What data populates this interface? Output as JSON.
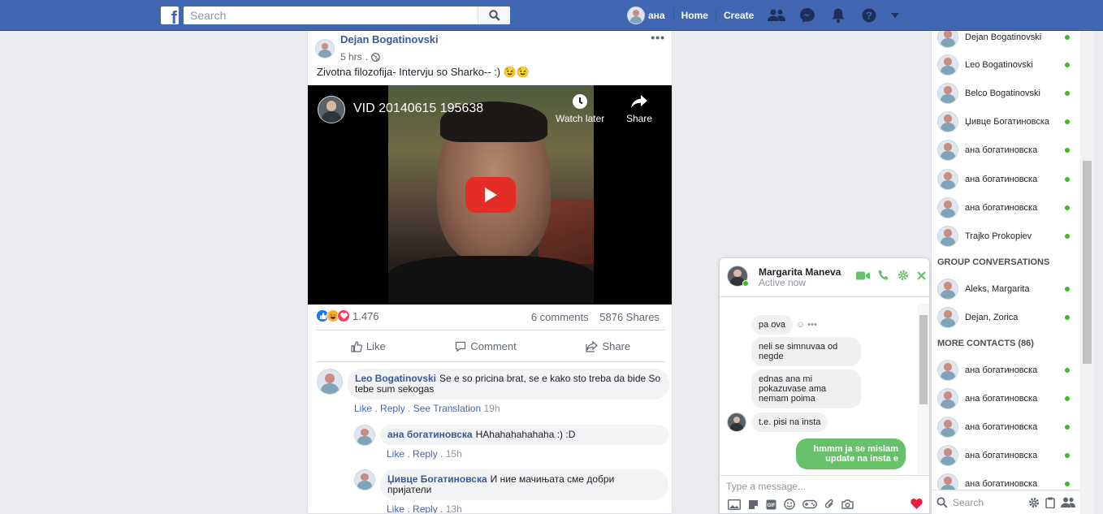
{
  "topbar": {
    "search_placeholder": "Search",
    "profile_name": "ана",
    "home": "Home",
    "create": "Create"
  },
  "post": {
    "author": "Dejan Bogatinovski",
    "time": "5 hrs",
    "time_sep": ".",
    "text": "Zivotna filozofija- Intervju so Sharko-- :) 😉😉",
    "video": {
      "title": "VID 20140615 195638",
      "watch_later": "Watch later",
      "share": "Share"
    },
    "reaction_count": "1.476",
    "comments_count": "6 comments",
    "shares_count": "5876 Shares",
    "actions": {
      "like": "Like",
      "comment": "Comment",
      "share": "Share"
    }
  },
  "comments": [
    {
      "name": "Leo Bogatinovski",
      "text": "Se e so pricina brat, se e kako sto treba da bide So tebe sum sekogas",
      "like": "Like",
      "reply": "Reply",
      "translation": "See Translation",
      "ago": "19h"
    },
    {
      "name": "ана богатиновска",
      "text": "HAhahahahahaha :) :D",
      "like": "Like",
      "reply": "Reply",
      "ago": "15h"
    },
    {
      "name": "Џивце Богатиновска",
      "text": "И ние мачињата сме добри пријатели",
      "like": "Like",
      "reply": "Reply",
      "ago": "13h"
    }
  ],
  "sidebar": {
    "contacts": [
      "Dejan Bogatinovski",
      "Leo Bogatinovski",
      "Belco Bogatinovski",
      "Џивце Богатиновска",
      "ана богатиновска",
      "ана богатиновска",
      "ана богатиновска",
      "Trajko Prokopiev"
    ],
    "group_title": "GROUP CONVERSATIONS",
    "groups": [
      "Aleks, Margarita",
      "Dejan, Zorica"
    ],
    "more_title": "MORE CONTACTS (86)",
    "more": [
      "ана богатиновска",
      "ана богатиновска",
      "ана богатиновска",
      "ана богатиновска",
      "ана богатиновска"
    ],
    "search_placeholder": "Search"
  },
  "chat": {
    "name": "Margarita Maneva",
    "status": "Active now",
    "messages": [
      {
        "from": "them",
        "text": "pa ova"
      },
      {
        "from": "them",
        "text": "neli se simnuvaa od negde"
      },
      {
        "from": "them",
        "text": "ednas ana mi pokazuvase ama nemam poima"
      },
      {
        "from": "them",
        "text": "t.e. pisi na insta"
      },
      {
        "from": "me",
        "text": "hmmm ja se mislam update na insta e"
      }
    ],
    "input_placeholder": "Type a message..."
  },
  "colors": {
    "brand": "#4267b2",
    "online": "#42b72a",
    "chat_me": "#67c16b",
    "heart": "#e41e3f"
  }
}
